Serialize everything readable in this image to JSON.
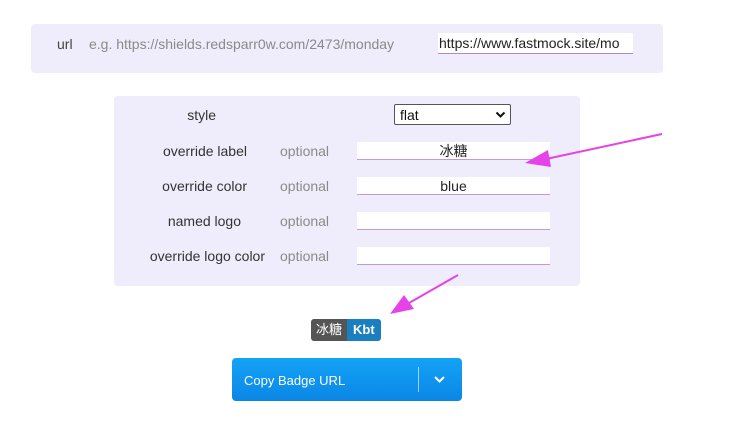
{
  "url_section": {
    "label": "url",
    "hint": "e.g. https://shields.redsparr0w.com/2473/monday",
    "value": "https://www.fastmock.site/mo"
  },
  "options": {
    "style": {
      "label": "style",
      "selected": "flat"
    },
    "rows": [
      {
        "label": "override label",
        "optional": "optional",
        "value": "冰糖"
      },
      {
        "label": "override color",
        "optional": "optional",
        "value": "blue"
      },
      {
        "label": "named logo",
        "optional": "optional",
        "value": ""
      },
      {
        "label": "override logo color",
        "optional": "optional",
        "value": ""
      }
    ]
  },
  "badge": {
    "left": "冰糖",
    "right": "Kbt",
    "left_color": "#555555",
    "right_color": "#1a7fbf"
  },
  "copy_button": {
    "label": "Copy Badge URL"
  },
  "annotation_color": "#e542e8"
}
